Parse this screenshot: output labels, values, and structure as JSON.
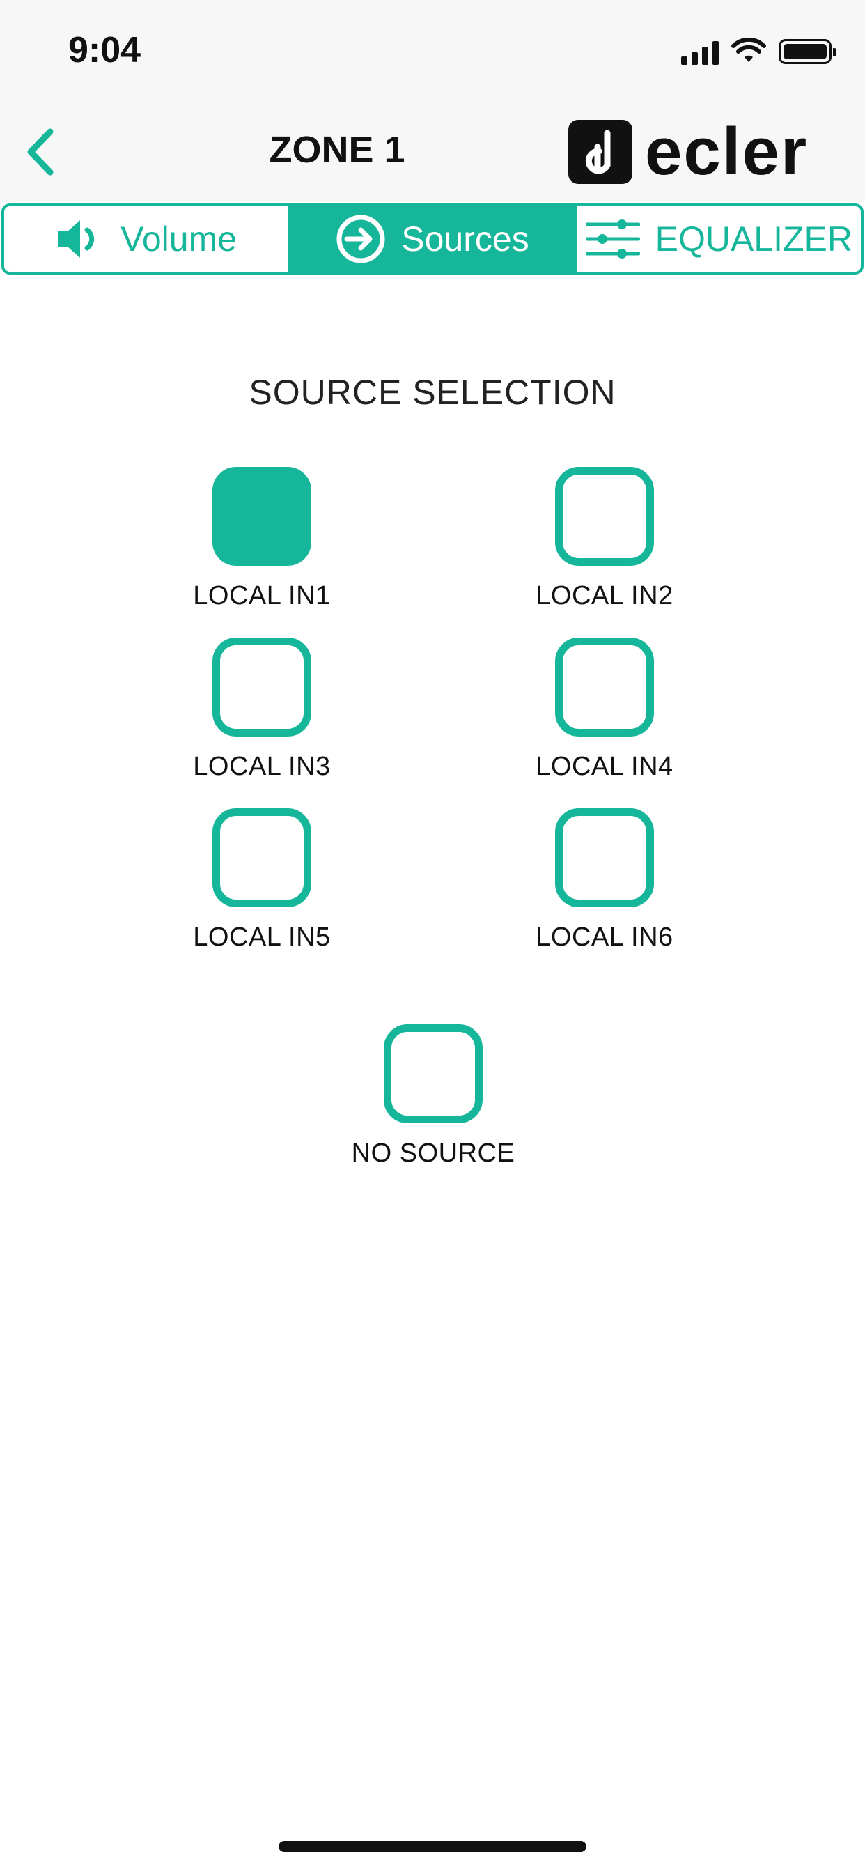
{
  "status_bar": {
    "time": "9:04"
  },
  "header": {
    "title": "ZONE 1",
    "logo_text": "ecler"
  },
  "tabs": [
    {
      "label": "Volume",
      "active": false
    },
    {
      "label": "Sources",
      "active": true
    },
    {
      "label": "EQUALIZER",
      "active": false
    }
  ],
  "main": {
    "heading": "SOURCE SELECTION",
    "sources": [
      {
        "label": "LOCAL IN1",
        "selected": true
      },
      {
        "label": "LOCAL IN2",
        "selected": false
      },
      {
        "label": "LOCAL IN3",
        "selected": false
      },
      {
        "label": "LOCAL IN4",
        "selected": false
      },
      {
        "label": "LOCAL IN5",
        "selected": false
      },
      {
        "label": "LOCAL IN6",
        "selected": false
      },
      {
        "label": "NO SOURCE",
        "selected": false
      }
    ]
  },
  "colors": {
    "accent": "#16b69b",
    "text": "#111111",
    "header_bg": "#f7f7f7"
  }
}
